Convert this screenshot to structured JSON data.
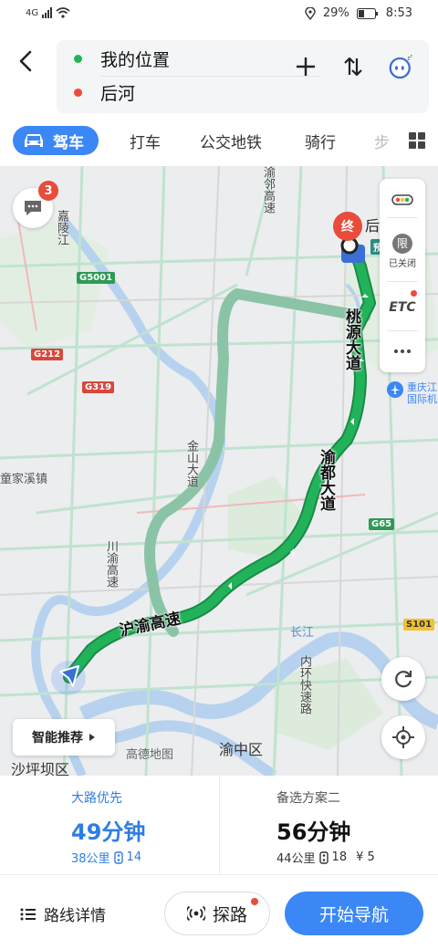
{
  "status_bar": {
    "network": "4G",
    "battery": "29%",
    "time": "8:53"
  },
  "header": {
    "start": "我的位置",
    "end": "后河"
  },
  "tabs": [
    {
      "label": "驾车"
    },
    {
      "label": "打车"
    },
    {
      "label": "公交地铁"
    },
    {
      "label": "骑行"
    },
    {
      "label": "步"
    }
  ],
  "map": {
    "message_count": "3",
    "end_marker": "终",
    "end_label": "后",
    "route_tag": "预",
    "right_panel": {
      "limit": "限",
      "limit_caption": "已关闭",
      "etc": "ETC"
    },
    "airport": {
      "line1": "重庆江",
      "line2": "国际机"
    },
    "labels": {
      "tongjiaxi": "童家溪镇",
      "shapingba": "沙坪坝区",
      "yuzhong": "渝中区",
      "changjiang": "长江",
      "gaode": "高德地图",
      "jialing": "嘉陵江",
      "chuanyu": "川渝高速",
      "jinshan": "金山大道",
      "neihuan": "内环快速路",
      "yangyuan": "渝邻高速"
    },
    "route_labels": {
      "taoyuan": "桃源大道",
      "yudu": "渝都大道",
      "huyu": "沪渝高速"
    },
    "badges": {
      "g5001": "G5001",
      "g212": "G212",
      "g319": "G319",
      "g65": "G65",
      "s101": "S101"
    },
    "smart_recommend": "智能推荐"
  },
  "options": [
    {
      "name": "大路优先",
      "time": "49分钟",
      "distance": "38公里",
      "lights": "14"
    },
    {
      "name": "备选方案二",
      "time": "56分钟",
      "distance": "44公里",
      "lights": "18",
      "toll": "¥ 5"
    }
  ],
  "bottom": {
    "details": "路线详情",
    "explore": "探路",
    "start": "开始导航"
  },
  "colors": {
    "accent": "#3b87f5",
    "route": "#22b35a",
    "alt_route": "#8bc3a6",
    "end_red": "#e94b3c"
  }
}
